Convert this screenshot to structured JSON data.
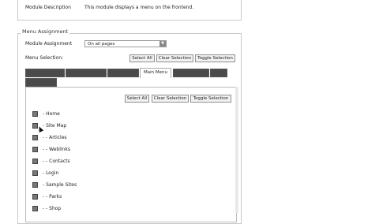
{
  "module": {
    "description_label": "Module Description",
    "description_value": "This module displays a menu on the frontend."
  },
  "menu_assignment": {
    "legend": "Menu Assignment",
    "assignment_label": "Module Assignment",
    "assignment_value": "On all pages",
    "selection_label": "Menu Selection:",
    "buttons": {
      "select_all": "Select All",
      "clear": "Clear Selection",
      "toggle": "Toggle Selection"
    },
    "tabs": {
      "active": "Main Menu"
    },
    "inner_buttons": {
      "select_all": "Select All",
      "clear": "Clear Selection",
      "toggle": "Toggle Selection"
    },
    "items": [
      "- Home",
      "- Site Map",
      "- - Articles",
      "- - Weblinks",
      "- - Contacts",
      "- Login",
      "- Sample Sites",
      "- - Parks",
      "- - Shop"
    ]
  }
}
